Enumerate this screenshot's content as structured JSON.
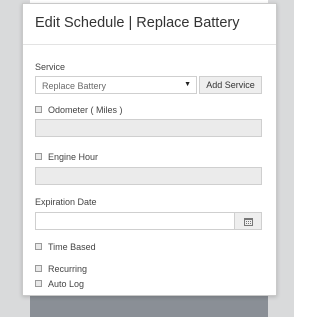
{
  "dialog": {
    "title": "Edit Schedule | Replace Battery"
  },
  "form": {
    "service": {
      "label": "Service",
      "selected": "Replace Battery",
      "add_button": "Add Service"
    },
    "odometer": {
      "label": "Odometer ( Miles )",
      "checked": false,
      "value": ""
    },
    "engine_hour": {
      "label": "Engine Hour",
      "checked": false,
      "value": ""
    },
    "expiration_date": {
      "label": "Expiration Date",
      "value": "",
      "icon": "calendar-icon"
    },
    "time_based": {
      "label": "Time Based",
      "checked": false
    },
    "recurring": {
      "label": "Recurring",
      "checked": false
    },
    "auto_log": {
      "label": "Auto Log",
      "checked": false
    }
  },
  "colors": {
    "backdrop": "#d9dadb",
    "disabled_field": "#ebebeb",
    "border": "#cfcfcf"
  }
}
